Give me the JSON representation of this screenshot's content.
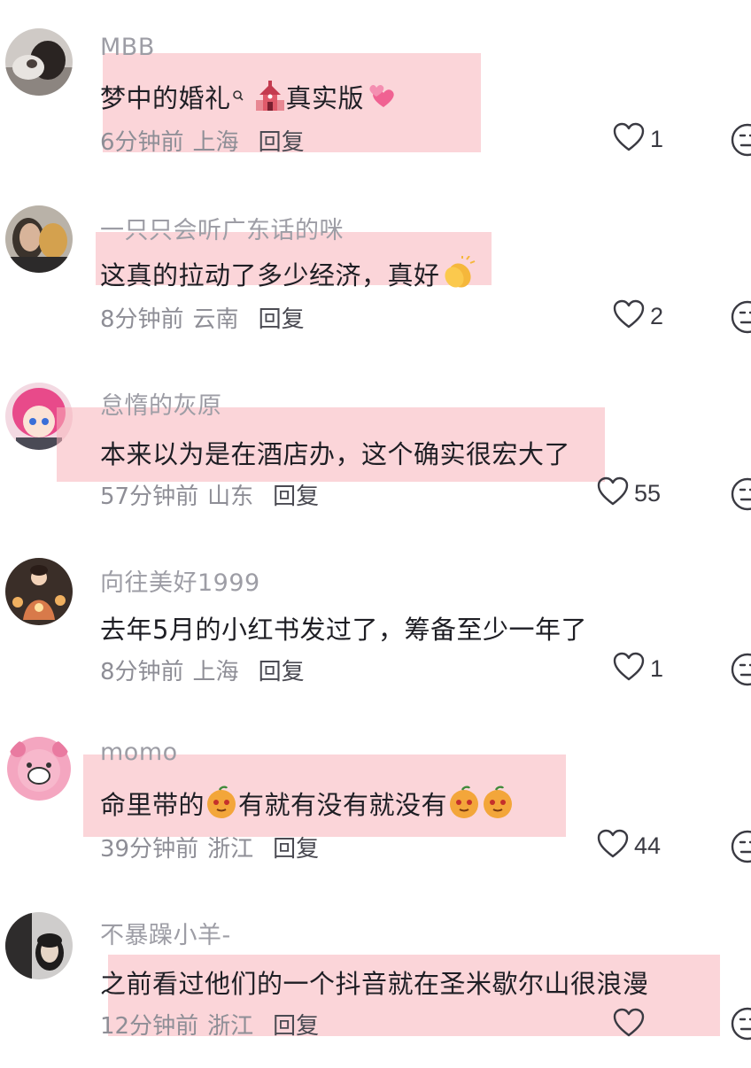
{
  "comments": [
    {
      "username": "MBB",
      "text_before": "梦中的婚礼",
      "text_middle": "",
      "text_after": "真实版",
      "time": "6分钟前",
      "location": "上海",
      "reply": "回复",
      "likes": "1",
      "emojis": [
        "magnifier-small-icon",
        "church-icon",
        "two-hearts-icon"
      ]
    },
    {
      "username": "一只只会听广东话的咪",
      "text_before": "这真的拉动了多少经济，真好",
      "time": "8分钟前",
      "location": "云南",
      "reply": "回复",
      "likes": "2",
      "emojis": [
        "clapping-hands-icon"
      ]
    },
    {
      "username": "怠惰的灰原",
      "text_before": "本来以为是在酒店办，这个确实很宏大了",
      "time": "57分钟前",
      "location": "山东",
      "reply": "回复",
      "likes": "55"
    },
    {
      "username": "向往美好1999",
      "text_before": "去年5月的小红书发过了，筹备至少一年了",
      "time": "8分钟前",
      "location": "上海",
      "reply": "回复",
      "likes": "1"
    },
    {
      "username": "momo",
      "text_before": "命里带的",
      "text_middle": "有就有没有就没有",
      "time": "39分钟前",
      "location": "浙江",
      "reply": "回复",
      "likes": "44",
      "emojis": [
        "orange-face-icon"
      ]
    },
    {
      "username": "不暴躁小羊-",
      "text_before": "之前看过他们的一个抖音就在圣米歇尔山很浪漫",
      "time": "12分钟前",
      "location": "浙江",
      "reply": "回复",
      "likes": ""
    }
  ],
  "colors": {
    "highlight": "#f8b2ba",
    "username": "#9d9da5",
    "content": "#1e1e24",
    "meta": "#8e8e96"
  }
}
